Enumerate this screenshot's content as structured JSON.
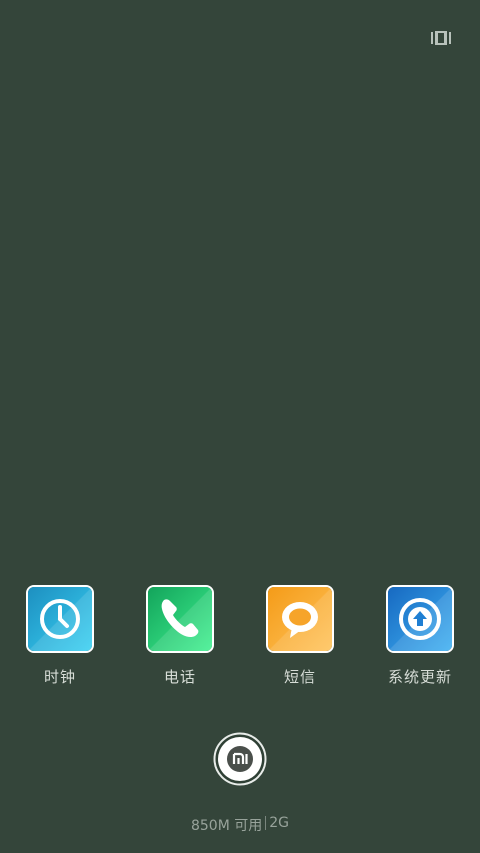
{
  "system": {
    "recent_icon": "recents-icon"
  },
  "apps": [
    {
      "label": "时钟",
      "icon": "clock-icon",
      "color": "#2bb7dd",
      "bg_dark": "#1d8fc0"
    },
    {
      "label": "电话",
      "icon": "phone-icon",
      "color": "#1fd47a",
      "bg_dark": "#13a45b"
    },
    {
      "label": "短信",
      "icon": "message-icon",
      "color": "#ffb43b",
      "bg_dark": "#f49b18"
    },
    {
      "label": "系统更新",
      "icon": "system-update-icon",
      "color": "#2b9be4",
      "bg_dark": "#1769c1"
    }
  ],
  "home_button": {
    "icon": "mi-logo-icon"
  },
  "memory": {
    "available": "850M 可用",
    "total": "2G"
  }
}
